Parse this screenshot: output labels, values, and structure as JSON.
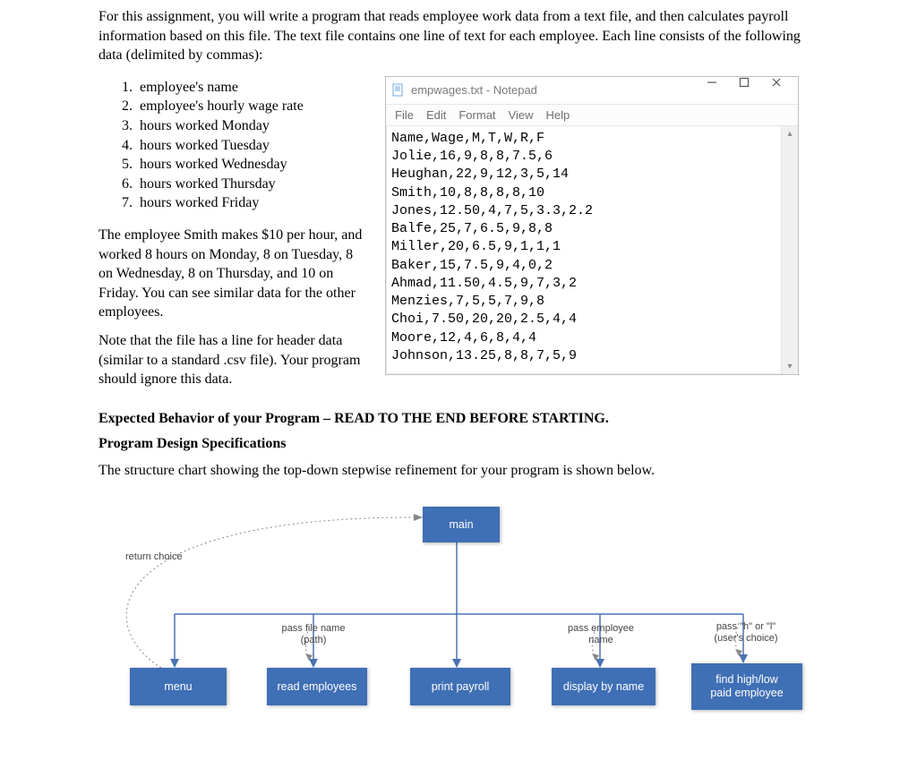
{
  "intro": "For this assignment, you will write a program that reads employee work data from a text file, and then calculates payroll information based on this file. The text file contains one line of text for each employee. Each line consists of the following data (delimited by commas):",
  "fields": [
    "employee's name",
    "employee's hourly wage rate",
    "hours worked Monday",
    "hours worked Tuesday",
    "hours worked Wednesday",
    "hours worked Thursday",
    "hours worked Friday"
  ],
  "para_smith": "The employee Smith makes $10 per hour, and worked 8 hours on Monday, 8 on Tuesday, 8 on Wednesday, 8 on Thursday, and 10 on Friday. You can see similar data for the other employees.",
  "para_note": "Note that the file has a line for header data (similar to a standard .csv file). Your program should ignore this data.",
  "headline_expected": "Expected Behavior of your Program – READ TO THE END BEFORE STARTING.",
  "headline_design": "Program Design Specifications",
  "chart_intro": "The structure chart showing the top-down stepwise refinement for your program is shown below.",
  "notepad": {
    "title": "empwages.txt - Notepad",
    "menu": [
      "File",
      "Edit",
      "Format",
      "View",
      "Help"
    ],
    "lines": [
      "Name,Wage,M,T,W,R,F",
      "Jolie,16,9,8,8,7.5,6",
      "Heughan,22,9,12,3,5,14",
      "Smith,10,8,8,8,8,10",
      "Jones,12.50,4,7,5,3.3,2.2",
      "Balfe,25,7,6.5,9,8,8",
      "Miller,20,6.5,9,1,1,1",
      "Baker,15,7.5,9,4,0,2",
      "Ahmad,11.50,4.5,9,7,3,2",
      "Menzies,7,5,5,7,9,8",
      "Choi,7.50,20,20,2.5,4,4",
      "Moore,12,4,6,8,4,4",
      "Johnson,13.25,8,8,7,5,9"
    ]
  },
  "chart": {
    "main": "main",
    "return_choice": "return choice",
    "menu": "menu",
    "read_employees": "read employees",
    "print_payroll": "print payroll",
    "display_by_name": "display by name",
    "find_high_low": "find high/low\npaid employee",
    "pass_file": "pass file\nname (path)",
    "pass_employee": "pass employee\nname",
    "pass_hl": "pass \"h\" or \"l\"\n(user's choice)"
  },
  "chart_data": {
    "type": "tree",
    "root": "main",
    "children": [
      "menu",
      "read employees",
      "print payroll",
      "display by name",
      "find high/low paid employee"
    ],
    "back_edge": {
      "from": "menu",
      "to": "main",
      "label": "return choice"
    },
    "edge_labels": {
      "read employees": "pass file name (path)",
      "display by name": "pass employee name",
      "find high/low paid employee": "pass \"h\" or \"l\" (user's choice)"
    }
  }
}
